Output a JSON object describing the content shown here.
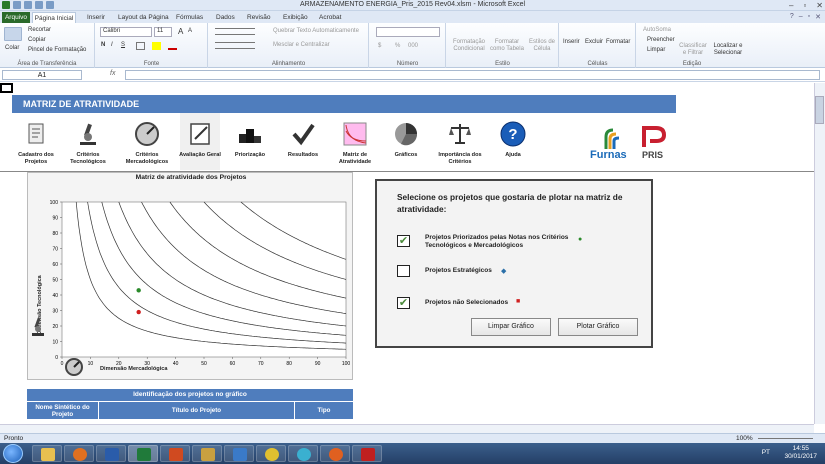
{
  "window": {
    "title": "ARMAZENAMENTO ENERGIA_Pris_2015 Rev04.xlsm - Microsoft Excel",
    "file_tab": "Arquivo"
  },
  "tabs": [
    "Página Inicial",
    "Inserir",
    "Layout da Página",
    "Fórmulas",
    "Dados",
    "Revisão",
    "Exibição",
    "Acrobat"
  ],
  "ribbon": {
    "clipboard": {
      "paste": "Colar",
      "cut": "Recortar",
      "copy": "Copiar",
      "format_painter": "Pincel de Formatação",
      "label": "Área de Transferência"
    },
    "font": {
      "name": "Calibri",
      "size": "11",
      "label": "Fonte",
      "bold": "N",
      "italic": "I",
      "underline": "S",
      "grow": "A",
      "shrink": "A"
    },
    "alignment": {
      "wrap": "Quebrar Texto Automaticamente",
      "merge": "Mesclar e Centralizar",
      "label": "Alinhamento"
    },
    "number": {
      "format": "",
      "label": "Número",
      "currency": "$",
      "percent": "%",
      "thousands": "000"
    },
    "style": {
      "conditional": "Formatação Condicional",
      "as_table": "Formatar como Tabela",
      "cell_styles": "Estilos de Célula",
      "label": "Estilo"
    },
    "cells": {
      "insert": "Inserir",
      "delete": "Excluir",
      "format": "Formatar",
      "label": "Células"
    },
    "editing": {
      "autosum": "AutoSoma",
      "fill": "Preencher",
      "clear": "Limpar",
      "sort": "Classificar e Filtrar",
      "find": "Localizar e Selecionar",
      "label": "Edição"
    }
  },
  "formula_bar": {
    "name_box": "A1",
    "fx": "fx",
    "value": ""
  },
  "header": {
    "title": "MATRIZ DE ATRATIVIDADE"
  },
  "nav": [
    {
      "label": "Cadastro dos Projetos",
      "icon": "document-icon"
    },
    {
      "label": "Critérios Tecnológicos",
      "icon": "microscope-icon"
    },
    {
      "label": "Critérios Mercadológicos",
      "icon": "gauge-icon"
    },
    {
      "label": "Avaliação Geral",
      "icon": "clipboard-icon"
    },
    {
      "label": "Priorização",
      "icon": "podium-icon"
    },
    {
      "label": "Resultados",
      "icon": "checkmark-icon"
    },
    {
      "label": "Matriz de Atratividade",
      "icon": "curves-icon"
    },
    {
      "label": "Gráficos",
      "icon": "pie-icon"
    },
    {
      "label": "Importância dos Critérios",
      "icon": "scale-icon"
    },
    {
      "label": "Ajuda",
      "icon": "help-icon"
    }
  ],
  "logos": {
    "furnas": "Furnas",
    "pris": "PRIS"
  },
  "chart_data": {
    "type": "scatter",
    "title": "Matriz de atratividade dos Projetos",
    "xlabel": "Dimensão Mercadológica",
    "ylabel": "Dimensão Tecnológica",
    "xlim": [
      0,
      100
    ],
    "ylim": [
      0,
      100
    ],
    "xticks": [
      "0",
      "10",
      "20",
      "30",
      "40",
      "50",
      "60",
      "70",
      "80",
      "90",
      "100"
    ],
    "yticks": [
      "0",
      "10",
      "20",
      "30",
      "40",
      "50",
      "60",
      "70",
      "80",
      "90",
      "100"
    ],
    "iso_curves_k": [
      500,
      900,
      1400,
      2000,
      2800,
      3800,
      5000,
      6300
    ],
    "series": [
      {
        "color": "#2a8a2a",
        "points": [
          [
            27,
            43
          ]
        ]
      },
      {
        "color": "#d02020",
        "points": [
          [
            27,
            29
          ]
        ]
      }
    ]
  },
  "selection_panel": {
    "title": "Selecione os projetos que gostaria de plotar na matriz de atratividade:",
    "options": [
      {
        "label": "Projetos Priorizados pelas Notas nos Critérios Tecnológicos e Mercadológicos",
        "checked": true,
        "marker_color": "#2a8a2a",
        "marker": "●"
      },
      {
        "label": "Projetos Estratégicos",
        "checked": false,
        "marker_color": "#2a6fa8",
        "marker": "◆"
      },
      {
        "label": "Projetos não Selecionados",
        "checked": true,
        "marker_color": "#d02020",
        "marker": "■"
      }
    ],
    "clear_button": "Limpar Gráfico",
    "plot_button": "Plotar Gráfico"
  },
  "table": {
    "title": "Identificação dos projetos no gráfico",
    "columns": [
      "Nome Sintético do Projeto",
      "Título do Projeto",
      "Tipo"
    ]
  },
  "status": {
    "ready": "Pronto",
    "zoom": "100%"
  },
  "taskbar": {
    "lang": "PT",
    "time": "14:55",
    "date": "30/01/2017"
  }
}
